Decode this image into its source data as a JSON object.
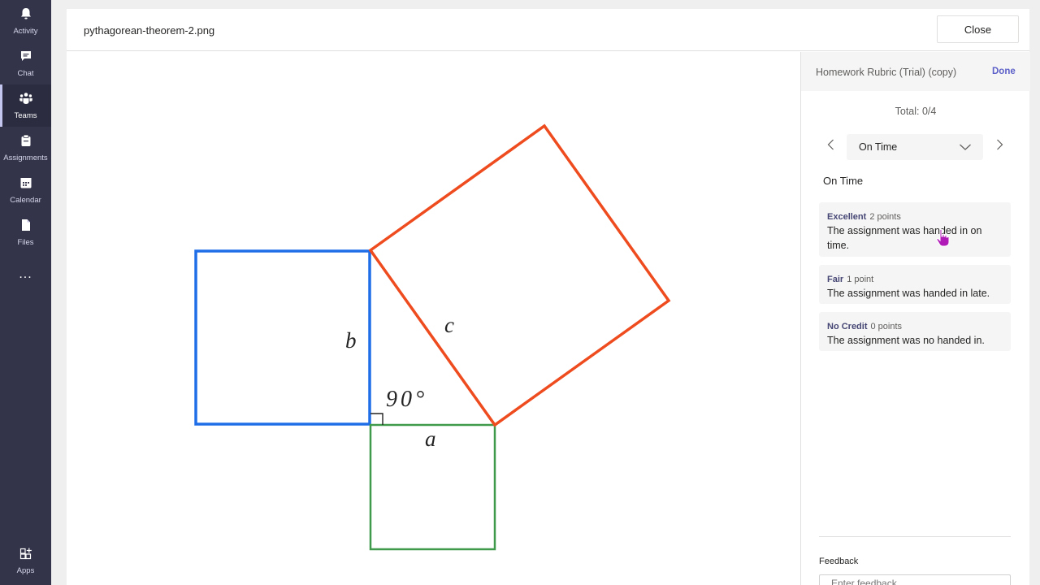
{
  "rail": {
    "items": [
      {
        "label": "Activity",
        "icon": "bell-icon"
      },
      {
        "label": "Chat",
        "icon": "chat-icon"
      },
      {
        "label": "Teams",
        "icon": "teams-icon"
      },
      {
        "label": "Assignments",
        "icon": "assignments-icon"
      },
      {
        "label": "Calendar",
        "icon": "calendar-icon"
      },
      {
        "label": "Files",
        "icon": "files-icon"
      },
      {
        "label": "...",
        "icon": "more-icon"
      }
    ],
    "apps_label": "Apps",
    "active": "Teams"
  },
  "viewer": {
    "file_name": "pythagorean-theorem-2.png",
    "close_label": "Close"
  },
  "figure": {
    "label_a": "a",
    "label_b": "b",
    "label_c": "c",
    "angle_label": "90°",
    "colors": {
      "a": "#3f9a4b",
      "b": "#1f6ee8",
      "c": "#ee4b1f"
    }
  },
  "rubric": {
    "title": "Homework Rubric (Trial) (copy)",
    "done_label": "Done",
    "total": "Total: 0/4",
    "selected_criterion": "On Time",
    "criterion_heading": "On Time",
    "levels": [
      {
        "name": "Excellent",
        "points": "2 points",
        "description": "The assignment was handed in on time."
      },
      {
        "name": "Fair",
        "points": "1 point",
        "description": "The assignment was handed in late."
      },
      {
        "name": "No Credit",
        "points": "0 points",
        "description": "The assignment was no handed in."
      }
    ],
    "feedback_label": "Feedback",
    "feedback_placeholder": "Enter feedback"
  },
  "accent_color": "#5b5fc7"
}
